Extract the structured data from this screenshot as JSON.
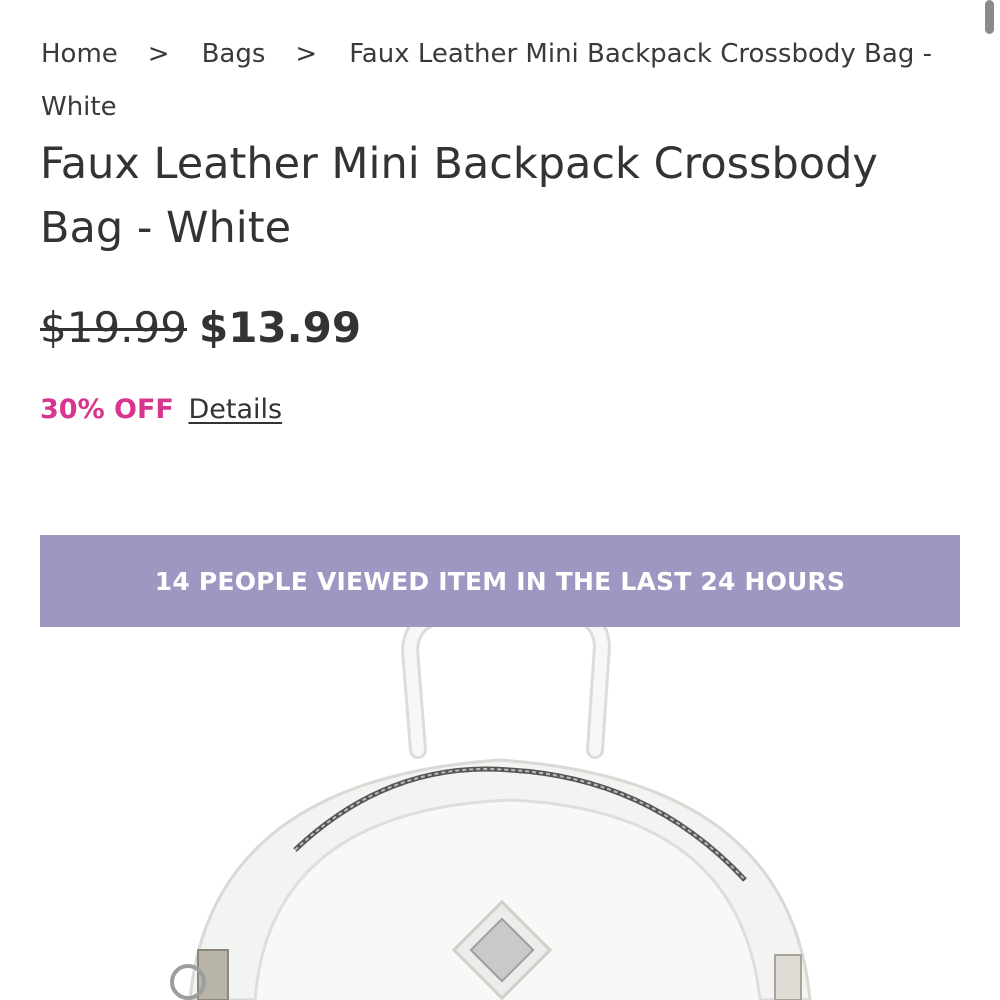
{
  "breadcrumb": {
    "home": "Home",
    "separator": ">",
    "category": "Bags",
    "current": "Faux Leather Mini Backpack Crossbody Bag - White"
  },
  "product": {
    "title": "Faux Leather Mini Backpack Crossbody Bag - White",
    "original_price": "$19.99",
    "sale_price": "$13.99",
    "discount": "30% OFF",
    "details_link": "Details"
  },
  "banner": {
    "text": "14 PEOPLE VIEWED ITEM IN THE LAST 24 HOURS",
    "color": "#9d98c2"
  },
  "colors": {
    "discount": "#d8358f",
    "text": "#333333"
  }
}
